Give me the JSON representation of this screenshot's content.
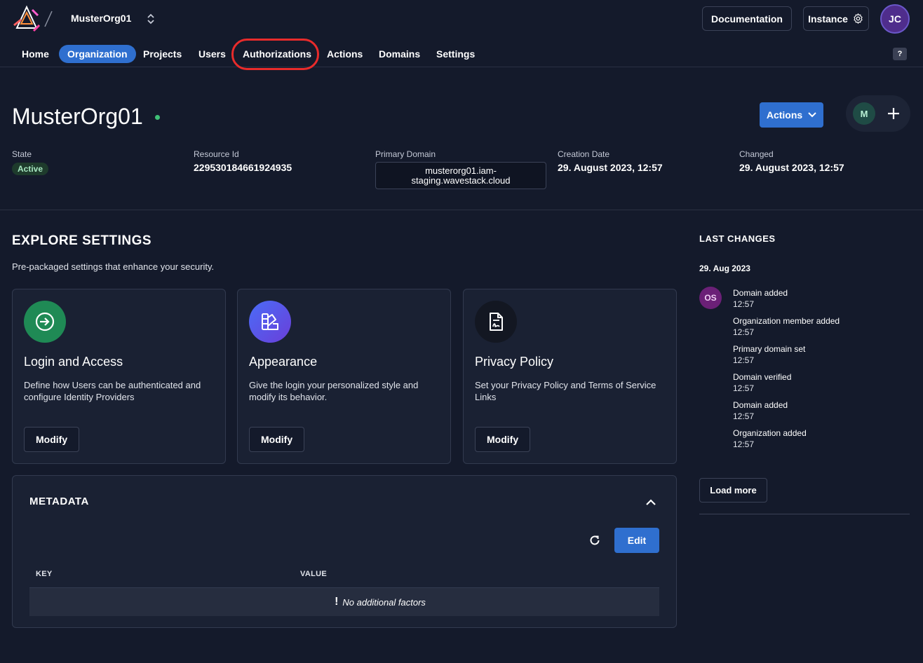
{
  "header": {
    "org_switcher": "MusterOrg01",
    "documentation_label": "Documentation",
    "instance_label": "Instance",
    "user_initials": "JC",
    "help_label": "?"
  },
  "nav": {
    "items": [
      {
        "label": "Home",
        "active": false
      },
      {
        "label": "Organization",
        "active": true
      },
      {
        "label": "Projects",
        "active": false
      },
      {
        "label": "Users",
        "active": false
      },
      {
        "label": "Authorizations",
        "active": false,
        "highlighted": true
      },
      {
        "label": "Actions",
        "active": false
      },
      {
        "label": "Domains",
        "active": false
      },
      {
        "label": "Settings",
        "active": false
      }
    ]
  },
  "org": {
    "name": "MusterOrg01",
    "actions_label": "Actions",
    "member_initial": "M",
    "state_label": "State",
    "state_value": "Active",
    "resource_id_label": "Resource Id",
    "resource_id_value": "229530184661924935",
    "primary_domain_label": "Primary Domain",
    "primary_domain_line1": "musterorg01.iam-",
    "primary_domain_line2": "staging.wavestack.cloud",
    "creation_date_label": "Creation Date",
    "creation_date_value": "29. August 2023, 12:57",
    "changed_label": "Changed",
    "changed_value": "29. August 2023, 12:57"
  },
  "explore": {
    "title": "EXPLORE SETTINGS",
    "subtitle": "Pre-packaged settings that enhance your security.",
    "cards": [
      {
        "title": "Login and Access",
        "description": "Define how Users can be authenticated and configure Identity Providers",
        "button": "Modify",
        "icon": "login-arrow-icon"
      },
      {
        "title": "Appearance",
        "description": "Give the login your personalized style and modify its behavior.",
        "button": "Modify",
        "icon": "palette-icon"
      },
      {
        "title": "Privacy Policy",
        "description": "Set your Privacy Policy and Terms of Service Links",
        "button": "Modify",
        "icon": "document-signature-icon"
      }
    ]
  },
  "metadata": {
    "title": "METADATA",
    "edit_label": "Edit",
    "col_key": "KEY",
    "col_value": "VALUE",
    "empty_text": "No additional factors"
  },
  "last_changes": {
    "title": "LAST CHANGES",
    "date": "29. Aug 2023",
    "editor_initials": "OS",
    "events": [
      {
        "action": "Domain added",
        "time": "12:57"
      },
      {
        "action": "Organization member added",
        "time": "12:57"
      },
      {
        "action": "Primary domain set",
        "time": "12:57"
      },
      {
        "action": "Domain verified",
        "time": "12:57"
      },
      {
        "action": "Domain added",
        "time": "12:57"
      },
      {
        "action": "Organization added",
        "time": "12:57"
      }
    ],
    "load_more_label": "Load more"
  },
  "colors": {
    "background": "#141a2b",
    "card": "#1a2133",
    "primary": "#2f6fcf",
    "highlight_ring": "#e82b2b",
    "status_active": "#3fbf76"
  }
}
